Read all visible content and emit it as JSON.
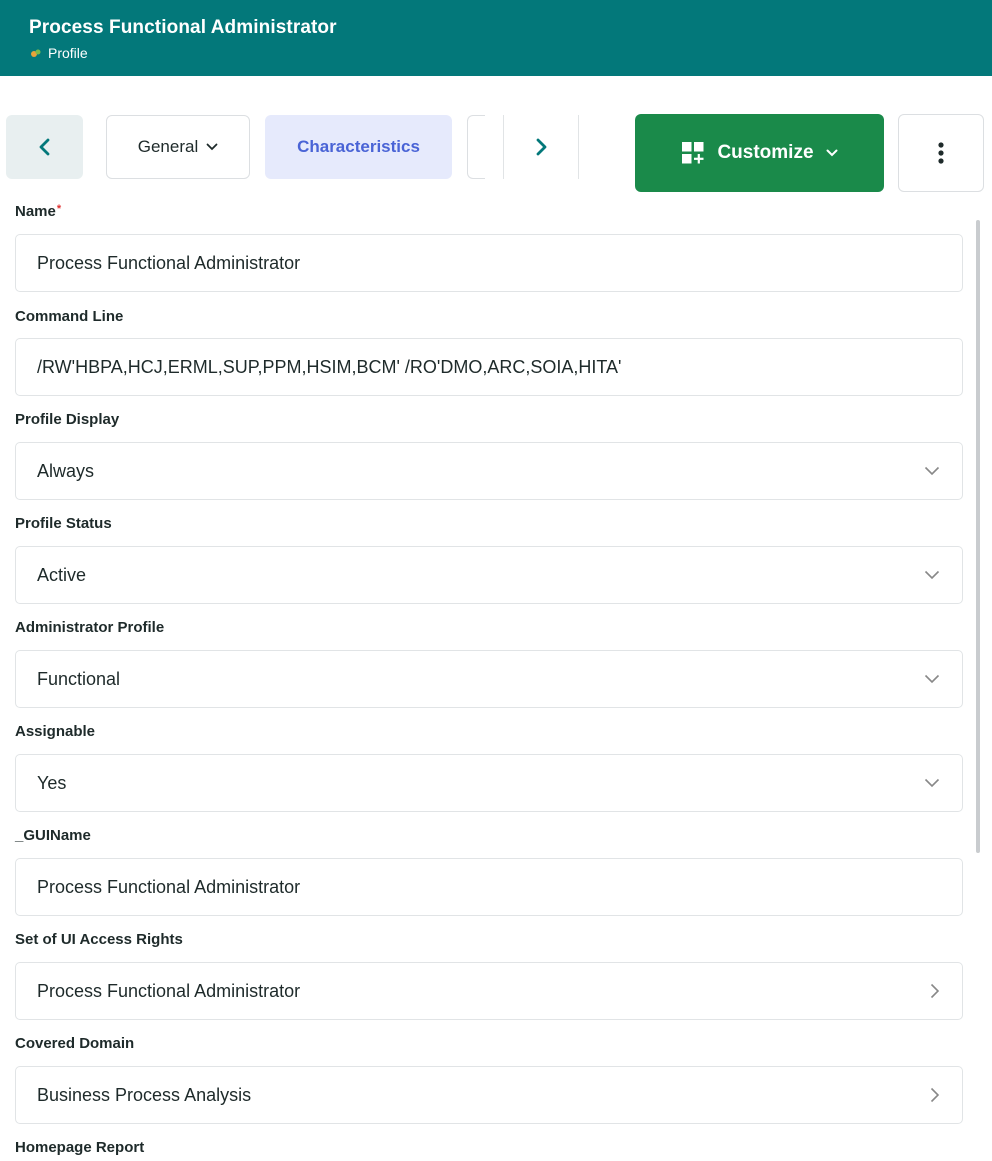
{
  "header": {
    "title": "Process Functional Administrator",
    "subtitle": "Profile",
    "subtitle_icon": "profile-icon"
  },
  "toolbar": {
    "prev_icon": "chevron-left-icon",
    "general_label": "General",
    "characteristics_label": "Characteristics",
    "next_icon": "chevron-right-icon",
    "customize_label": "Customize",
    "more_icon": "vertical-dots-icon"
  },
  "fields": {
    "name_label": "Name",
    "name_value": "Process Functional Administrator",
    "command_line_label": "Command Line",
    "command_line_value": "/RW'HBPA,HCJ,ERML,SUP,PPM,HSIM,BCM' /RO'DMO,ARC,SOIA,HITA'",
    "profile_display_label": "Profile Display",
    "profile_display_value": "Always",
    "profile_status_label": "Profile Status",
    "profile_status_value": "Active",
    "administrator_profile_label": "Administrator Profile",
    "administrator_profile_value": "Functional",
    "assignable_label": "Assignable",
    "assignable_value": "Yes",
    "gui_name_label": "_GUIName",
    "gui_name_value": "Process Functional Administrator",
    "ui_access_rights_label": "Set of UI Access Rights",
    "ui_access_rights_value": "Process Functional Administrator",
    "covered_domain_label": "Covered Domain",
    "covered_domain_value": "Business Process Analysis",
    "homepage_report_label": "Homepage Report"
  },
  "colors": {
    "header_bg": "#03787a",
    "customize_bg": "#1a8a4a",
    "active_tab_bg": "#e6eafc",
    "active_tab_text": "#4a64d6",
    "required": "#e03030"
  }
}
